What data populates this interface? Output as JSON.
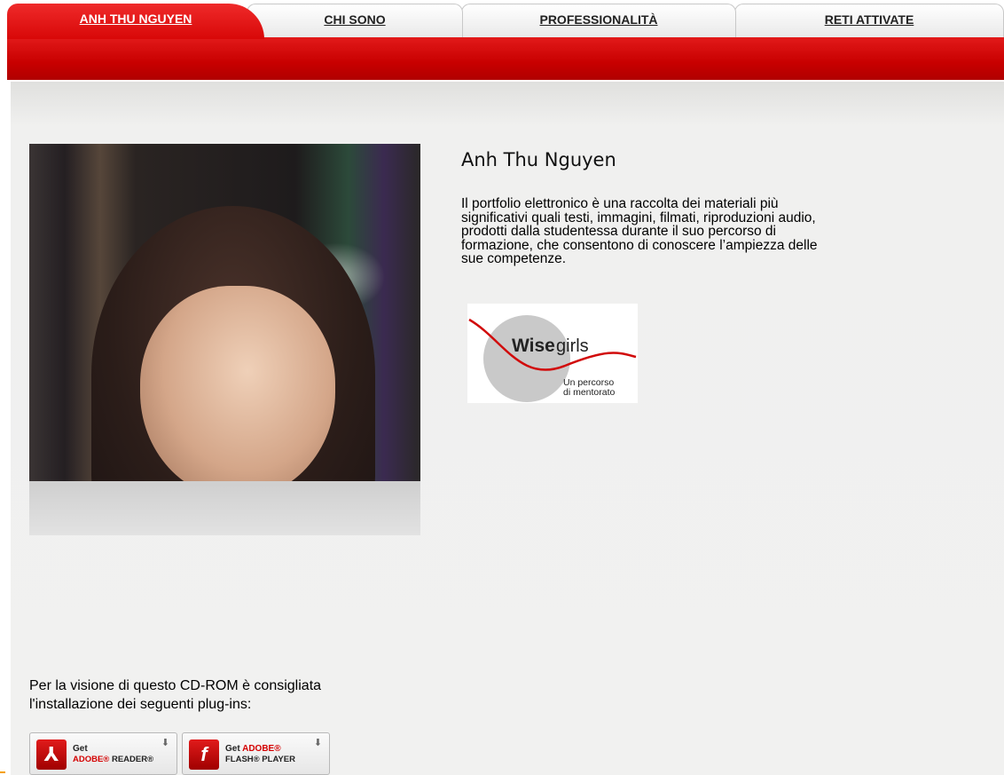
{
  "nav": {
    "tabs": [
      {
        "label": "ANH THU NGUYEN",
        "active": true
      },
      {
        "label": "CHI SONO",
        "active": false
      },
      {
        "label": "PROFESSIONALITÀ",
        "active": false
      },
      {
        "label": "RETI ATTIVATE",
        "active": false
      }
    ]
  },
  "profile": {
    "name": "Anh Thu Nguyen",
    "description": "Il portfolio elettronico è  una raccolta dei materiali più\nsignificativi quali testi, immagini, filmati, riproduzioni audio,\nprodotti dalla studentessa  durante il suo percorso di\nformazione, che consentono di conoscere l’ampiezza delle\nsue competenze."
  },
  "logo": {
    "wise": "Wise",
    "girls": "girls",
    "subtitle": "Un percorso\ndi mentorato"
  },
  "plugins": {
    "note": "Per la visione di questo CD-ROM è consigliata\nl'installazione dei seguenti plug-ins:",
    "reader": {
      "get": "Get",
      "brand": "ADOBE®",
      "product": "READER®"
    },
    "flash": {
      "get": "Get",
      "brand": "ADOBE®",
      "product": "FLASH® PLAYER"
    }
  },
  "colors": {
    "accent_red": "#d80808",
    "panel_bg": "#f1f1f0"
  }
}
